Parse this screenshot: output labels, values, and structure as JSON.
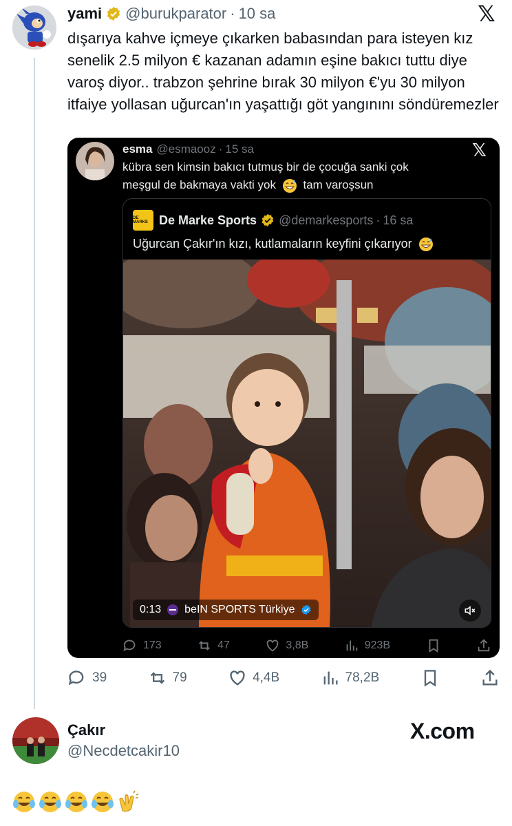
{
  "main_tweet": {
    "name": "yami",
    "handle": "@burukparator",
    "separator": "·",
    "time": "10 sa",
    "text": "dışarıya kahve içmeye çıkarken babasından para isteyen kız senelik 2.5 milyon € kazanan adamın eşine bakıcı tuttu diye varoş diyor.. trabzon şehrine bırak 30 milyon €'yu 30 milyon itfaiye yollasan uğurcan'ın yaşattığı göt yangınını söndüremezler",
    "platform_icon": "x-logo-icon",
    "stats": {
      "replies": "39",
      "reposts": "79",
      "likes": "4,4B",
      "views": "78,2B"
    }
  },
  "quoted_tweet": {
    "name": "esma",
    "handle": "@esmaooz",
    "separator": "·",
    "time": "15 sa",
    "text_line1": "kübra sen kimsin bakıcı tutmuş bir de çocuğa sanki çok",
    "text_line2": "meşgul de bakmaya vakti yok",
    "text_line2_end": "tam varoşsun",
    "stats": {
      "replies": "173",
      "reposts": "47",
      "likes": "3,8B",
      "views": "923B"
    }
  },
  "nested_quote": {
    "logo_text": "DE MARKE",
    "name": "De Marke Sports",
    "handle": "@demarkesports",
    "separator": "·",
    "time": "16 sa",
    "text": "Uğurcan Çakır'ın kızı, kutlamaların keyfini çıkarıyor",
    "video": {
      "duration": "0:13",
      "source": "beIN SPORTS Türkiye"
    }
  },
  "reply": {
    "name": "Çakır",
    "handle": "@Necdetcakir10",
    "watermark": "X.com",
    "emojis": "😂😂😂😂👏"
  },
  "colors": {
    "verified_gold": "#e2b719",
    "verified_blue": "#1d9bf0",
    "muted": "#536471",
    "card_bg": "#000000"
  }
}
